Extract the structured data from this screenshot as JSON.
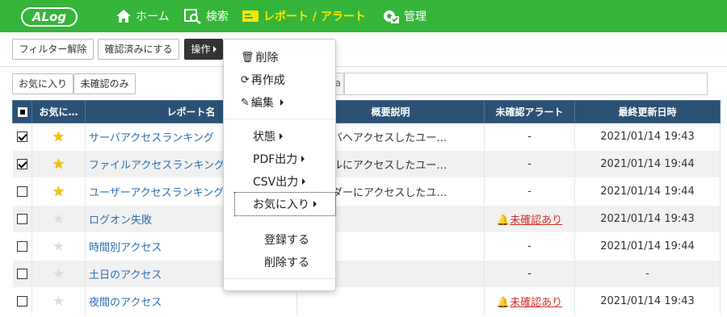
{
  "header": {
    "logo": "ALog",
    "nav": [
      {
        "label": "ホーム",
        "icon": "home-icon"
      },
      {
        "label": "検索",
        "icon": "search-icon"
      },
      {
        "label": "レポート / アラート",
        "icon": "report-icon",
        "active": true
      },
      {
        "label": "管理",
        "icon": "gear-check-icon"
      }
    ]
  },
  "toolbar": {
    "clear_filter": "フィルター解除",
    "mark_confirmed": "確認済みにする",
    "operation": "操作"
  },
  "filters": {
    "favorites": "お気に入り",
    "unconfirmed_only": "未確認のみ"
  },
  "search_partial_text": "a",
  "table": {
    "headers": [
      "",
      "お気に…",
      "レポート名",
      "概要説明",
      "未確認アラート",
      "最終更新日時"
    ],
    "rows": [
      {
        "checked": true,
        "fav": true,
        "name": "サーバアクセスランキング",
        "desc": "ルサーバへアクセスしたユー…",
        "alert": "-",
        "updated": "2021/01/14 19:43"
      },
      {
        "checked": true,
        "fav": true,
        "name": "ファイルアクセスランキング",
        "desc": "ファイルにアクセスしたユー…",
        "alert": "-",
        "updated": "2021/01/14 19:44"
      },
      {
        "checked": false,
        "fav": true,
        "name": "ユーザーアクセスランキング",
        "desc": "フォルダーにアクセスしたユ…",
        "alert": "-",
        "updated": "2021/01/14 19:44"
      },
      {
        "checked": false,
        "fav": false,
        "name": "ログオン失敗",
        "desc": "",
        "alert": "未確認あり",
        "updated": "2021/01/14 19:43"
      },
      {
        "checked": false,
        "fav": false,
        "name": "時間別アクセス",
        "desc": "",
        "alert": "-",
        "updated": "2021/01/14 19:44"
      },
      {
        "checked": false,
        "fav": false,
        "name": "土日のアクセス",
        "desc": "",
        "alert": "-",
        "updated": "-"
      },
      {
        "checked": false,
        "fav": false,
        "name": "夜間のアクセス",
        "desc": "",
        "alert": "未確認あり",
        "updated": "2021/01/14 19:43"
      }
    ]
  },
  "menu": {
    "delete": "削除",
    "recreate": "再作成",
    "edit": "編集",
    "status": "状態",
    "pdf": "PDF出力",
    "csv": "CSV出力",
    "favorites": "お気に入り",
    "register": "登録する",
    "remove": "削除する"
  },
  "colors": {
    "header_bg": "#35b53a",
    "active_nav": "#ffe600",
    "table_header": "#2b5275",
    "link": "#2a6db3",
    "alert": "#d0302a"
  }
}
